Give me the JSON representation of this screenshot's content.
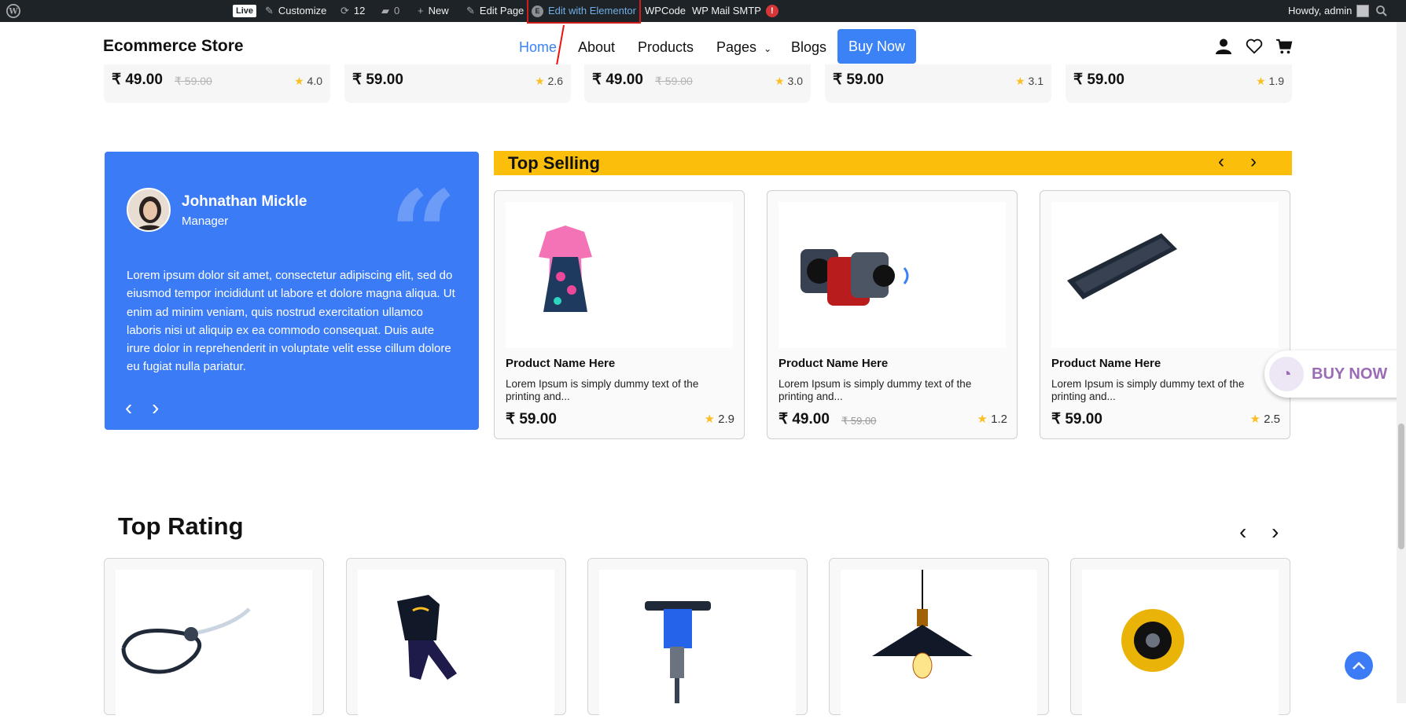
{
  "admin_bar": {
    "live": "Live",
    "customize": "Customize",
    "updates": "12",
    "comments": "0",
    "new": "New",
    "edit_page": "Edit Page",
    "edit_elementor": "Edit with Elementor",
    "wpcode": "WPCode",
    "wp_mail_smtp": "WP Mail SMTP",
    "smtp_badge": "!",
    "howdy": "Howdy, admin"
  },
  "header": {
    "logo": "Ecommerce Store",
    "nav": [
      "Home",
      "About",
      "Products",
      "Pages",
      "Blogs"
    ],
    "buy_now": "Buy Now",
    "accent": "#3b82f6"
  },
  "top_row": [
    {
      "price": "₹ 49.00",
      "old": "₹ 59.00",
      "rating": "4.0"
    },
    {
      "price": "₹ 59.00",
      "old": "",
      "rating": "2.6"
    },
    {
      "price": "₹ 49.00",
      "old": "₹ 59.00",
      "rating": "3.0"
    },
    {
      "price": "₹ 59.00",
      "old": "",
      "rating": "3.1"
    },
    {
      "price": "₹ 59.00",
      "old": "",
      "rating": "1.9"
    }
  ],
  "testimonial": {
    "name": "Johnathan Mickle",
    "role": "Manager",
    "quote_mark": "“",
    "body": "Lorem ipsum dolor sit amet, consectetur adipiscing elit, sed do eiusmod tempor incididunt ut labore et dolore magna aliqua. Ut enim ad minim veniam, quis nostrud exercitation ullamco laboris nisi ut aliquip ex ea commodo consequat. Duis aute irure dolor in reprehenderit in voluptate velit esse cillum dolore eu fugiat nulla pariatur.",
    "bg": "#3b7bf6"
  },
  "top_selling": {
    "title": "Top Selling",
    "bar_color": "#fbbf0b",
    "products": [
      {
        "name": "Product Name Here",
        "desc": "Lorem Ipsum is simply dummy text of the printing and...",
        "price": "₹ 59.00",
        "old": "",
        "rating": "2.9",
        "image": "dress"
      },
      {
        "name": "Product Name Here",
        "desc": "Lorem Ipsum is simply dummy text of the printing and...",
        "price": "₹ 49.00",
        "old": "₹ 59.00",
        "rating": "1.2",
        "image": "speakers"
      },
      {
        "name": "Product Name Here",
        "desc": "Lorem Ipsum is simply dummy text of the printing and...",
        "price": "₹ 59.00",
        "old": "",
        "rating": "2.5",
        "image": "keyboard"
      }
    ]
  },
  "float_buy": "BUY NOW",
  "top_rating": {
    "title": "Top Rating",
    "items": [
      "stethoscope",
      "kids-clothes",
      "jackhammer",
      "pendant-lamp",
      "speaker"
    ]
  },
  "icons": {
    "star": "★",
    "prev": "‹",
    "next": "›",
    "up": "^"
  }
}
